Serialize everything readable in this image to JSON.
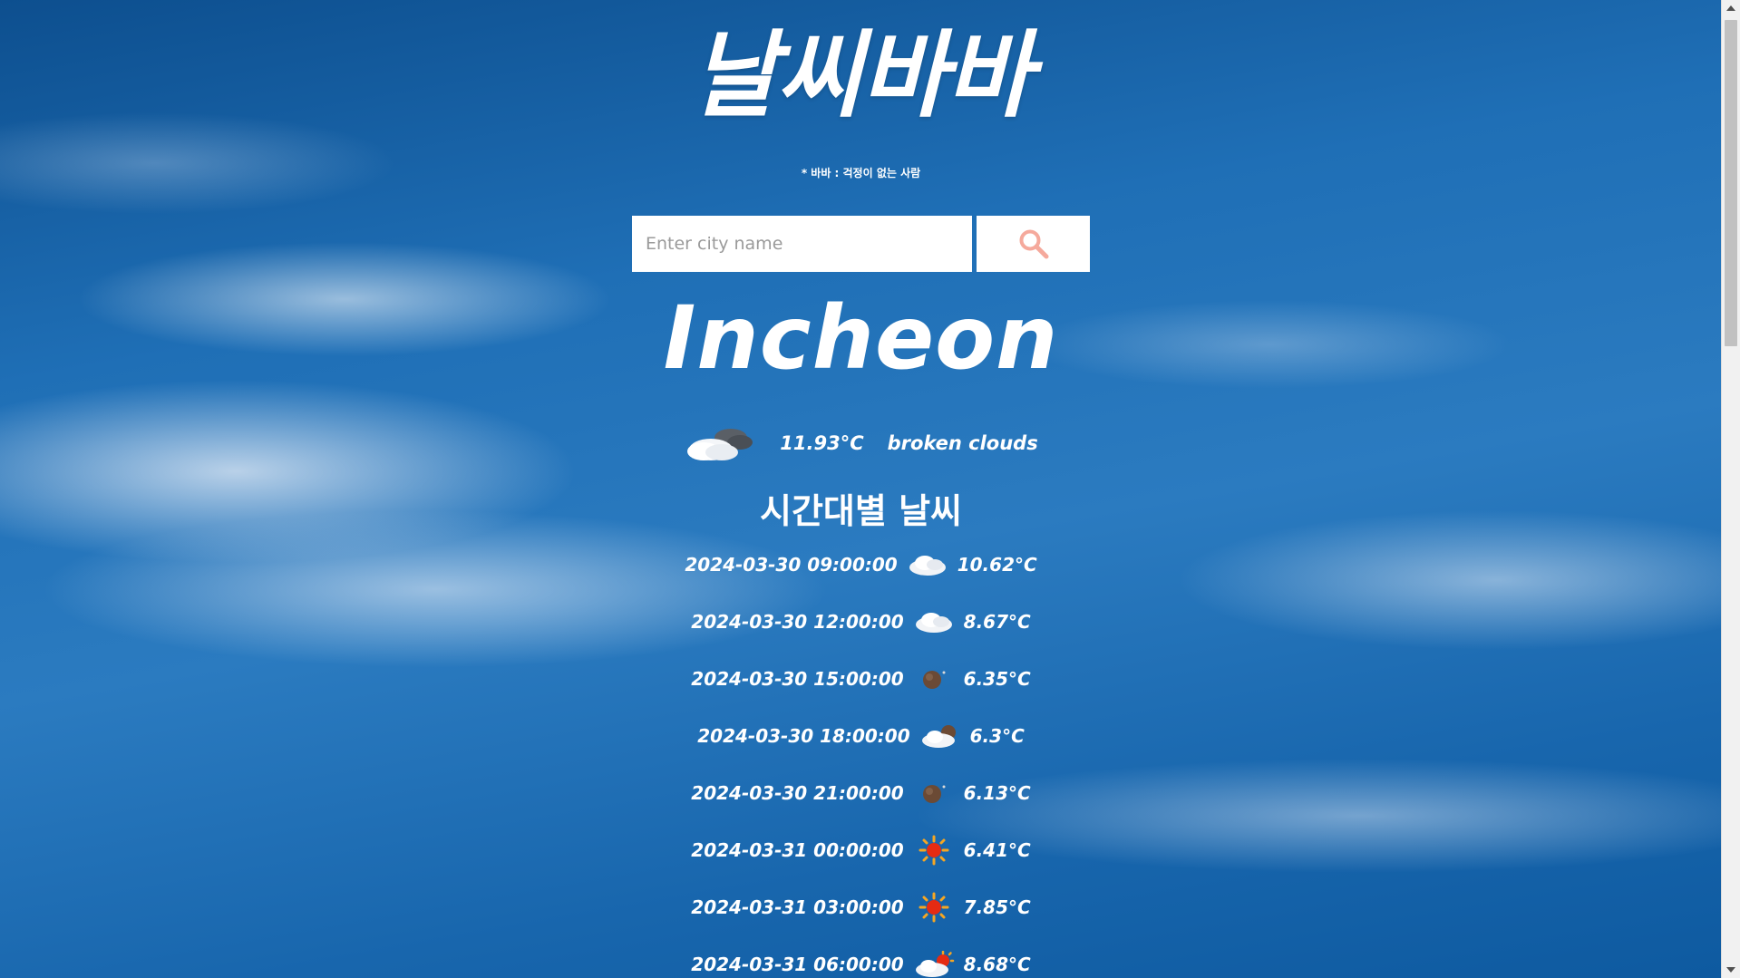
{
  "header": {
    "title": "날씨바바",
    "subtitle": "* 바바 : 걱정이 없는 사람"
  },
  "search": {
    "placeholder": "Enter city name",
    "value": "",
    "button_icon": "search-icon",
    "icon_color": "#f5a99c"
  },
  "current": {
    "city": "Incheon",
    "icon": "broken-clouds-icon",
    "temperature": "11.93°C",
    "description": "broken clouds"
  },
  "hourly": {
    "heading": "시간대별 날씨",
    "items": [
      {
        "time": "2024-03-30 09:00:00",
        "icon": "overcast-clouds-icon",
        "temp": "10.62°C"
      },
      {
        "time": "2024-03-30 12:00:00",
        "icon": "overcast-clouds-icon",
        "temp": "8.67°C"
      },
      {
        "time": "2024-03-30 15:00:00",
        "icon": "clear-night-icon",
        "temp": "6.35°C"
      },
      {
        "time": "2024-03-30 18:00:00",
        "icon": "broken-clouds-night-icon",
        "temp": "6.3°C"
      },
      {
        "time": "2024-03-30 21:00:00",
        "icon": "clear-night-icon",
        "temp": "6.13°C"
      },
      {
        "time": "2024-03-31 00:00:00",
        "icon": "clear-sun-icon",
        "temp": "6.41°C"
      },
      {
        "time": "2024-03-31 03:00:00",
        "icon": "clear-sun-icon",
        "temp": "7.85°C"
      },
      {
        "time": "2024-03-31 06:00:00",
        "icon": "few-clouds-sun-icon",
        "temp": "8.68°C"
      }
    ]
  },
  "colors": {
    "sky_blue": "#1f6fb6",
    "text": "#ffffff",
    "search_icon": "#f5a99c"
  }
}
